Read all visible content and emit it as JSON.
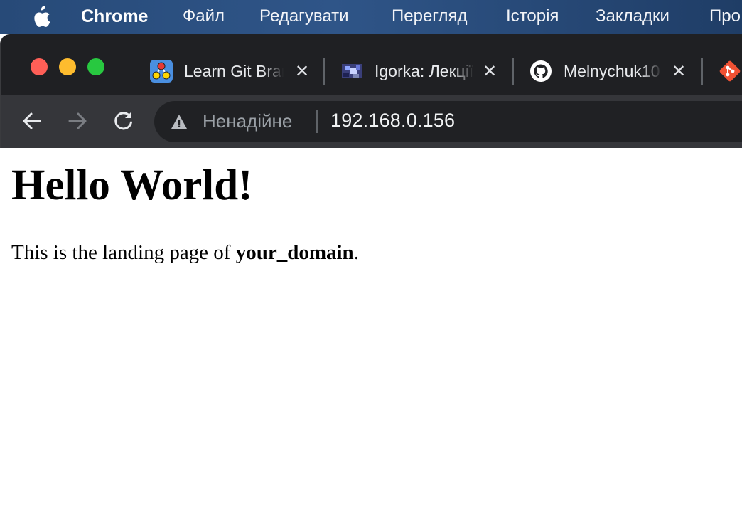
{
  "menubar": {
    "app_name": "Chrome",
    "items": [
      "Файл",
      "Редагувати",
      "Перегляд",
      "Історія",
      "Закладки",
      "Про"
    ]
  },
  "tabs": [
    {
      "title": "Learn Git Branching",
      "icon": "git-branching-icon"
    },
    {
      "title": "Igorka: Лекції",
      "icon": "pixel-art-icon"
    },
    {
      "title": "Melnychuk10",
      "icon": "github-icon"
    },
    {
      "title": "",
      "icon": "git-icon"
    }
  ],
  "omnibox": {
    "security_label": "Ненадійне",
    "url": "192.168.0.156"
  },
  "page": {
    "heading": "Hello World!",
    "text_before": "This is the landing page of ",
    "domain": "your_domain",
    "text_after": "."
  },
  "colors": {
    "menubar": "#2f5588",
    "tabstrip": "#1f2023",
    "toolbar": "#35363a",
    "omnibox": "#202124",
    "close": "#fe5f57",
    "minimize": "#febc2e",
    "maximize": "#28c840"
  }
}
